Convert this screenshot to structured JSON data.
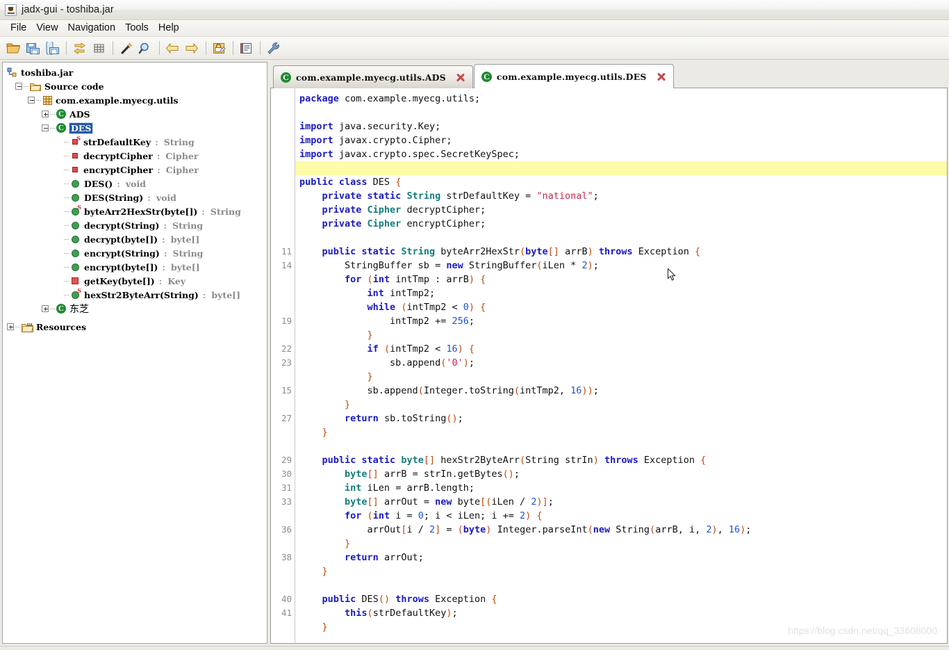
{
  "window": {
    "title": "jadx-gui - toshiba.jar",
    "app_icon": "java-cup-icon"
  },
  "menubar": {
    "items": [
      {
        "label": "File"
      },
      {
        "label": "View"
      },
      {
        "label": "Navigation"
      },
      {
        "label": "Tools"
      },
      {
        "label": "Help"
      }
    ]
  },
  "toolbar": {
    "buttons": [
      {
        "name": "open-file-icon",
        "glyph": "folder-open"
      },
      {
        "name": "save-all-icon",
        "glyph": "save-all"
      },
      {
        "name": "save-as-icon",
        "glyph": "save-as"
      },
      {
        "name": "sync-icon",
        "glyph": "arrows-swap"
      },
      {
        "name": "flatten-packages-icon",
        "glyph": "grid"
      },
      {
        "name": "deobfuscation-icon",
        "glyph": "magic-wand"
      },
      {
        "name": "search-icon",
        "glyph": "magnifier"
      },
      {
        "name": "back-icon",
        "glyph": "arrow-left"
      },
      {
        "name": "forward-icon",
        "glyph": "arrow-right"
      },
      {
        "name": "decompile-icon",
        "glyph": "lock-edit"
      },
      {
        "name": "log-icon",
        "glyph": "notebook"
      },
      {
        "name": "preferences-icon",
        "glyph": "wrench"
      }
    ]
  },
  "tree": {
    "nodes": [
      {
        "depth": 0,
        "twisty": "none",
        "icon": "jar-icon",
        "label": "toshiba.jar",
        "sig": ""
      },
      {
        "depth": 1,
        "twisty": "minus",
        "icon": "folder-icon",
        "label": "Source code",
        "sig": ""
      },
      {
        "depth": 2,
        "twisty": "minus",
        "icon": "package-icon",
        "label": "com.example.myecg.utils",
        "sig": ""
      },
      {
        "depth": 3,
        "twisty": "plus",
        "icon": "class-icon",
        "label": "ADS",
        "sig": ""
      },
      {
        "depth": 3,
        "twisty": "minus",
        "icon": "class-icon",
        "label": "DES",
        "sig": "",
        "selected": true
      },
      {
        "depth": 4,
        "twisty": "none",
        "icon": "field-static-icon",
        "label": "strDefaultKey",
        "sig": "String"
      },
      {
        "depth": 4,
        "twisty": "none",
        "icon": "field-icon",
        "label": "decryptCipher",
        "sig": "Cipher"
      },
      {
        "depth": 4,
        "twisty": "none",
        "icon": "field-icon",
        "label": "encryptCipher",
        "sig": "Cipher"
      },
      {
        "depth": 4,
        "twisty": "none",
        "icon": "method-icon",
        "label": "DES()",
        "sig": "void"
      },
      {
        "depth": 4,
        "twisty": "none",
        "icon": "method-icon",
        "label": "DES(String)",
        "sig": "void"
      },
      {
        "depth": 4,
        "twisty": "none",
        "icon": "method-static-icon",
        "label": "byteArr2HexStr(byte[])",
        "sig": "String"
      },
      {
        "depth": 4,
        "twisty": "none",
        "icon": "method-icon",
        "label": "decrypt(String)",
        "sig": "String"
      },
      {
        "depth": 4,
        "twisty": "none",
        "icon": "method-icon",
        "label": "decrypt(byte[])",
        "sig": "byte[]"
      },
      {
        "depth": 4,
        "twisty": "none",
        "icon": "method-icon",
        "label": "encrypt(String)",
        "sig": "String"
      },
      {
        "depth": 4,
        "twisty": "none",
        "icon": "method-icon",
        "label": "encrypt(byte[])",
        "sig": "byte[]"
      },
      {
        "depth": 4,
        "twisty": "none",
        "icon": "method-private-icon",
        "label": "getKey(byte[])",
        "sig": "Key"
      },
      {
        "depth": 4,
        "twisty": "none",
        "icon": "method-static-icon",
        "label": "hexStr2ByteArr(String)",
        "sig": "byte[]"
      },
      {
        "depth": 3,
        "twisty": "plus",
        "icon": "class-icon",
        "label": "东芝",
        "sig": ""
      },
      {
        "depth": 0,
        "twisty": "plus",
        "icon": "resources-icon",
        "label": "Resources",
        "sig": ""
      }
    ]
  },
  "tabs": [
    {
      "label": "com.example.myecg.utils.ADS",
      "icon": "class-icon",
      "active": false,
      "close": "close-icon"
    },
    {
      "label": "com.example.myecg.utils.DES",
      "icon": "class-icon",
      "active": true,
      "close": "close-icon"
    }
  ],
  "editor": {
    "highlighted_line_index": 5,
    "lines": [
      {
        "num": "",
        "tokens": [
          [
            "kw",
            "package"
          ],
          [
            "pln",
            " com.example.myecg.utils;"
          ]
        ]
      },
      {
        "num": "",
        "tokens": [
          [
            "pln",
            ""
          ]
        ]
      },
      {
        "num": "",
        "tokens": [
          [
            "kw",
            "import"
          ],
          [
            "pln",
            " java.security.Key;"
          ]
        ]
      },
      {
        "num": "",
        "tokens": [
          [
            "kw",
            "import"
          ],
          [
            "pln",
            " javax.crypto.Cipher;"
          ]
        ]
      },
      {
        "num": "",
        "tokens": [
          [
            "kw",
            "import"
          ],
          [
            "pln",
            " javax.crypto.spec.SecretKeySpec;"
          ]
        ]
      },
      {
        "num": "",
        "tokens": [
          [
            "pln",
            ""
          ]
        ]
      },
      {
        "num": "",
        "tokens": [
          [
            "kw",
            "public class "
          ],
          [
            "pln",
            "DES "
          ],
          [
            "brc",
            "{"
          ]
        ]
      },
      {
        "num": "",
        "tokens": [
          [
            "pln",
            "    "
          ],
          [
            "kw",
            "private static "
          ],
          [
            "typ",
            "String"
          ],
          [
            "pln",
            " strDefaultKey = "
          ],
          [
            "str",
            "\"national\""
          ],
          [
            "pln",
            ";"
          ]
        ]
      },
      {
        "num": "",
        "tokens": [
          [
            "pln",
            "    "
          ],
          [
            "kw",
            "private "
          ],
          [
            "typ",
            "Cipher"
          ],
          [
            "pln",
            " decryptCipher;"
          ]
        ]
      },
      {
        "num": "",
        "tokens": [
          [
            "pln",
            "    "
          ],
          [
            "kw",
            "private "
          ],
          [
            "typ",
            "Cipher"
          ],
          [
            "pln",
            " encryptCipher;"
          ]
        ]
      },
      {
        "num": "",
        "tokens": [
          [
            "pln",
            ""
          ]
        ]
      },
      {
        "num": "11",
        "tokens": [
          [
            "pln",
            "    "
          ],
          [
            "kw",
            "public static "
          ],
          [
            "typ",
            "String"
          ],
          [
            "pln",
            " byteArr2HexStr"
          ],
          [
            "prn",
            "("
          ],
          [
            "kw",
            "byte"
          ],
          [
            "brc",
            "[]"
          ],
          [
            "pln",
            " arrB"
          ],
          [
            "prn",
            ")"
          ],
          [
            "kw",
            " throws "
          ],
          [
            "pln",
            "Exception "
          ],
          [
            "brc",
            "{"
          ]
        ]
      },
      {
        "num": "14",
        "tokens": [
          [
            "pln",
            "        StringBuffer sb = "
          ],
          [
            "kw",
            "new"
          ],
          [
            "pln",
            " StringBuffer"
          ],
          [
            "prn",
            "("
          ],
          [
            "pln",
            "iLen * "
          ],
          [
            "num",
            "2"
          ],
          [
            "prn",
            ")"
          ],
          [
            "pln",
            ";"
          ]
        ]
      },
      {
        "num": "",
        "tokens": [
          [
            "pln",
            "        "
          ],
          [
            "kw",
            "for "
          ],
          [
            "prn",
            "("
          ],
          [
            "kw",
            "int"
          ],
          [
            "pln",
            " intTmp : arrB"
          ],
          [
            "prn",
            ")"
          ],
          [
            "pln",
            " "
          ],
          [
            "brc",
            "{"
          ]
        ]
      },
      {
        "num": "",
        "tokens": [
          [
            "pln",
            "            "
          ],
          [
            "kw",
            "int"
          ],
          [
            "pln",
            " intTmp2;"
          ]
        ]
      },
      {
        "num": "",
        "tokens": [
          [
            "pln",
            "            "
          ],
          [
            "kw",
            "while "
          ],
          [
            "prn",
            "("
          ],
          [
            "pln",
            "intTmp2 < "
          ],
          [
            "num",
            "0"
          ],
          [
            "prn",
            ")"
          ],
          [
            "pln",
            " "
          ],
          [
            "brc",
            "{"
          ]
        ]
      },
      {
        "num": "19",
        "tokens": [
          [
            "pln",
            "                intTmp2 += "
          ],
          [
            "num",
            "256"
          ],
          [
            "pln",
            ";"
          ]
        ]
      },
      {
        "num": "",
        "tokens": [
          [
            "pln",
            "            "
          ],
          [
            "brc",
            "}"
          ]
        ]
      },
      {
        "num": "22",
        "tokens": [
          [
            "pln",
            "            "
          ],
          [
            "kw",
            "if "
          ],
          [
            "prn",
            "("
          ],
          [
            "pln",
            "intTmp2 < "
          ],
          [
            "num",
            "16"
          ],
          [
            "prn",
            ")"
          ],
          [
            "pln",
            " "
          ],
          [
            "brc",
            "{"
          ]
        ]
      },
      {
        "num": "23",
        "tokens": [
          [
            "pln",
            "                sb.append"
          ],
          [
            "prn",
            "("
          ],
          [
            "str",
            "'0'"
          ],
          [
            "prn",
            ")"
          ],
          [
            "pln",
            ";"
          ]
        ]
      },
      {
        "num": "",
        "tokens": [
          [
            "pln",
            "            "
          ],
          [
            "brc",
            "}"
          ]
        ]
      },
      {
        "num": "15",
        "tokens": [
          [
            "pln",
            "            sb.append"
          ],
          [
            "prn",
            "("
          ],
          [
            "pln",
            "Integer.toString"
          ],
          [
            "prn",
            "("
          ],
          [
            "pln",
            "intTmp2, "
          ],
          [
            "num",
            "16"
          ],
          [
            "prn",
            "))"
          ],
          [
            "pln",
            ";"
          ]
        ]
      },
      {
        "num": "",
        "tokens": [
          [
            "pln",
            "        "
          ],
          [
            "brc",
            "}"
          ]
        ]
      },
      {
        "num": "27",
        "tokens": [
          [
            "pln",
            "        "
          ],
          [
            "kw",
            "return"
          ],
          [
            "pln",
            " sb.toString"
          ],
          [
            "prn",
            "()"
          ],
          [
            "pln",
            ";"
          ]
        ]
      },
      {
        "num": "",
        "tokens": [
          [
            "pln",
            "    "
          ],
          [
            "brc",
            "}"
          ]
        ]
      },
      {
        "num": "",
        "tokens": [
          [
            "pln",
            ""
          ]
        ]
      },
      {
        "num": "29",
        "tokens": [
          [
            "pln",
            "    "
          ],
          [
            "kw",
            "public static "
          ],
          [
            "typ",
            "byte"
          ],
          [
            "brc",
            "[]"
          ],
          [
            "pln",
            " hexStr2ByteArr"
          ],
          [
            "prn",
            "("
          ],
          [
            "pln",
            "String strIn"
          ],
          [
            "prn",
            ")"
          ],
          [
            "kw",
            " throws "
          ],
          [
            "pln",
            "Exception "
          ],
          [
            "brc",
            "{"
          ]
        ]
      },
      {
        "num": "30",
        "tokens": [
          [
            "pln",
            "        "
          ],
          [
            "typ",
            "byte"
          ],
          [
            "brc",
            "[]"
          ],
          [
            "pln",
            " arrB = strIn.getBytes"
          ],
          [
            "prn",
            "()"
          ],
          [
            "pln",
            ";"
          ]
        ]
      },
      {
        "num": "31",
        "tokens": [
          [
            "pln",
            "        "
          ],
          [
            "typ",
            "int"
          ],
          [
            "pln",
            " iLen = arrB.length;"
          ]
        ]
      },
      {
        "num": "33",
        "tokens": [
          [
            "pln",
            "        "
          ],
          [
            "typ",
            "byte"
          ],
          [
            "brc",
            "[]"
          ],
          [
            "pln",
            " arrOut = "
          ],
          [
            "kw",
            "new"
          ],
          [
            "pln",
            " byte"
          ],
          [
            "brc",
            "["
          ],
          [
            "prn",
            "("
          ],
          [
            "pln",
            "iLen / "
          ],
          [
            "num",
            "2"
          ],
          [
            "prn",
            ")"
          ],
          [
            "brc",
            "]"
          ],
          [
            "pln",
            ";"
          ]
        ]
      },
      {
        "num": "",
        "tokens": [
          [
            "pln",
            "        "
          ],
          [
            "kw",
            "for "
          ],
          [
            "prn",
            "("
          ],
          [
            "kw",
            "int"
          ],
          [
            "pln",
            " i = "
          ],
          [
            "num",
            "0"
          ],
          [
            "pln",
            "; i < iLen; i += "
          ],
          [
            "num",
            "2"
          ],
          [
            "prn",
            ")"
          ],
          [
            "pln",
            " "
          ],
          [
            "brc",
            "{"
          ]
        ]
      },
      {
        "num": "36",
        "tokens": [
          [
            "pln",
            "            arrOut"
          ],
          [
            "brc",
            "["
          ],
          [
            "pln",
            "i / "
          ],
          [
            "num",
            "2"
          ],
          [
            "brc",
            "]"
          ],
          [
            "pln",
            " = "
          ],
          [
            "prn",
            "("
          ],
          [
            "kw",
            "byte"
          ],
          [
            "prn",
            ")"
          ],
          [
            "pln",
            " Integer.parseInt"
          ],
          [
            "prn",
            "("
          ],
          [
            "kw",
            "new"
          ],
          [
            "pln",
            " String"
          ],
          [
            "prn",
            "("
          ],
          [
            "pln",
            "arrB, i, "
          ],
          [
            "num",
            "2"
          ],
          [
            "prn",
            ")"
          ],
          [
            "pln",
            ", "
          ],
          [
            "num",
            "16"
          ],
          [
            "prn",
            ")"
          ],
          [
            "pln",
            ";"
          ]
        ]
      },
      {
        "num": "",
        "tokens": [
          [
            "pln",
            "        "
          ],
          [
            "brc",
            "}"
          ]
        ]
      },
      {
        "num": "38",
        "tokens": [
          [
            "pln",
            "        "
          ],
          [
            "kw",
            "return"
          ],
          [
            "pln",
            " arrOut;"
          ]
        ]
      },
      {
        "num": "",
        "tokens": [
          [
            "pln",
            "    "
          ],
          [
            "brc",
            "}"
          ]
        ]
      },
      {
        "num": "",
        "tokens": [
          [
            "pln",
            ""
          ]
        ]
      },
      {
        "num": "40",
        "tokens": [
          [
            "pln",
            "    "
          ],
          [
            "kw",
            "public "
          ],
          [
            "pln",
            "DES"
          ],
          [
            "prn",
            "()"
          ],
          [
            "kw",
            " throws "
          ],
          [
            "pln",
            "Exception "
          ],
          [
            "brc",
            "{"
          ]
        ]
      },
      {
        "num": "41",
        "tokens": [
          [
            "pln",
            "        "
          ],
          [
            "kw",
            "this"
          ],
          [
            "prn",
            "("
          ],
          [
            "pln",
            "strDefaultKey"
          ],
          [
            "prn",
            ")"
          ],
          [
            "pln",
            ";"
          ]
        ]
      },
      {
        "num": "",
        "tokens": [
          [
            "pln",
            "    "
          ],
          [
            "brc",
            "}"
          ]
        ]
      }
    ]
  },
  "watermark": {
    "text": "https://blog.csdn.net/qq_33608000"
  }
}
